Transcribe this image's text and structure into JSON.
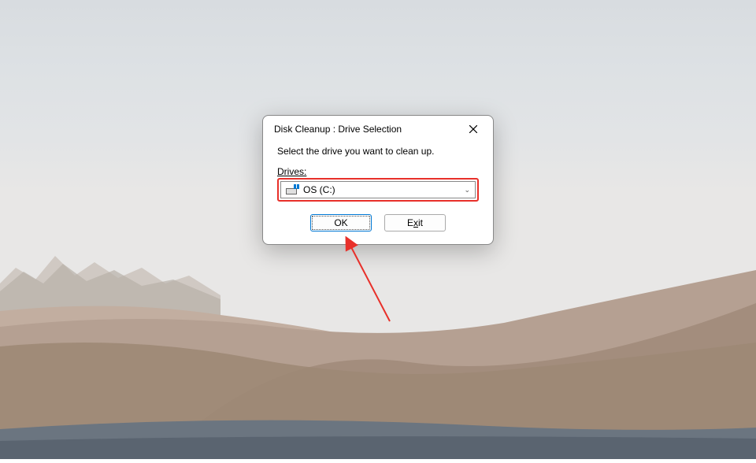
{
  "dialog": {
    "title": "Disk Cleanup : Drive Selection",
    "instruction": "Select the drive you want to clean up.",
    "drives_label": "Drives:",
    "selected_drive": "OS (C:)",
    "buttons": {
      "ok": "OK",
      "exit": "Exit"
    }
  },
  "annotation": {
    "highlight_color": "#e8302a",
    "arrow_target": "ok-button"
  }
}
